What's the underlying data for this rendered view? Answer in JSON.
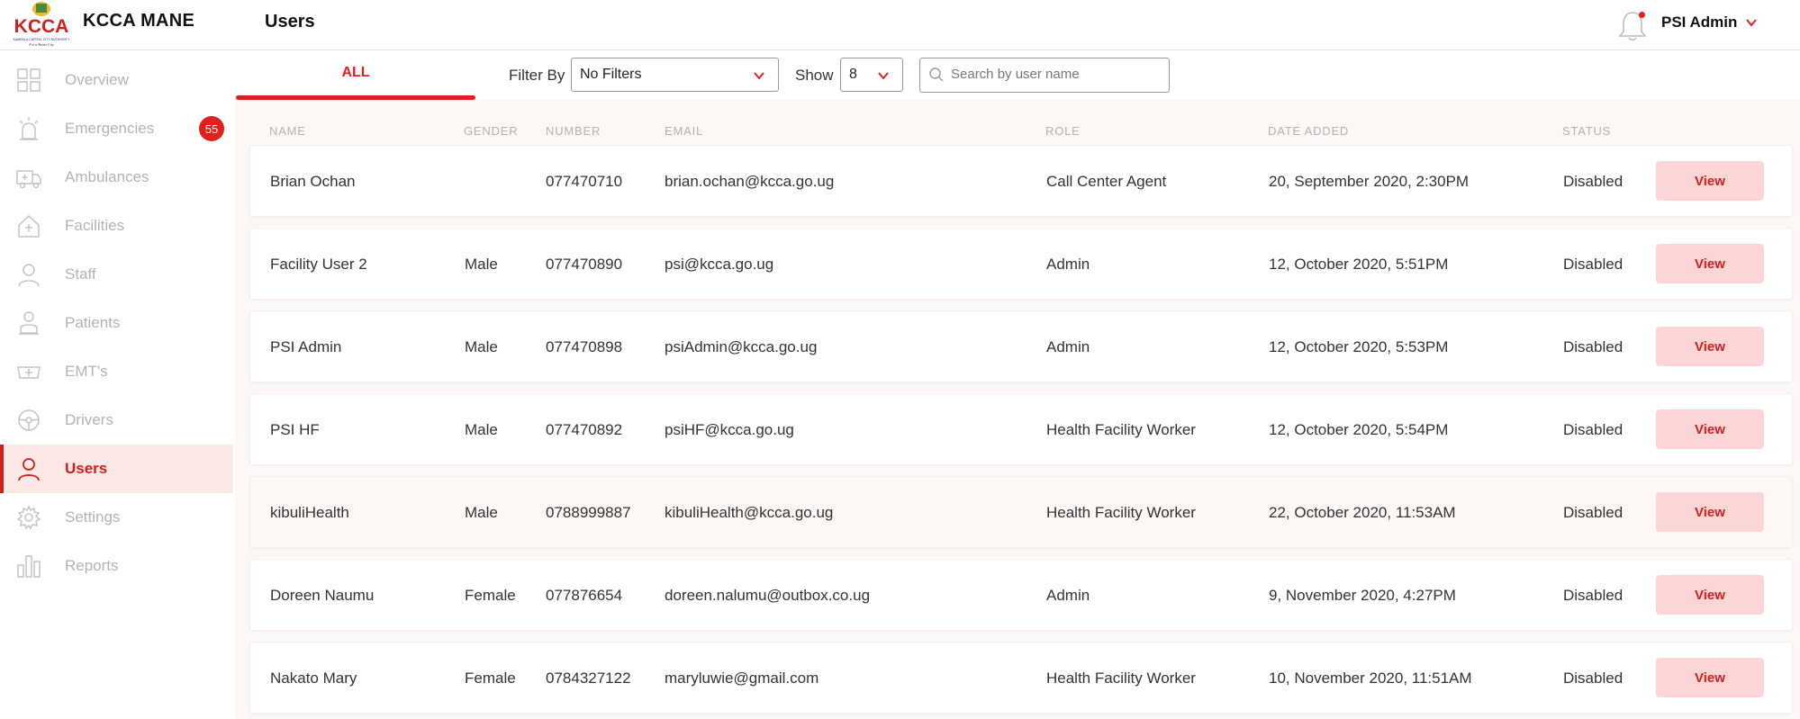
{
  "header": {
    "logo_text": "KCCA",
    "logo_subtext": "KAMPALA CAPITAL CITY AUTHORITY",
    "logo_tagline": "For a Better City",
    "app_name": "KCCA MANE",
    "page_title": "Users",
    "user_name": "PSI Admin"
  },
  "sidebar": {
    "items": [
      {
        "label": "Overview",
        "icon": "grid-icon"
      },
      {
        "label": "Emergencies",
        "icon": "siren-icon",
        "badge": "55"
      },
      {
        "label": "Ambulances",
        "icon": "ambulance-icon"
      },
      {
        "label": "Facilities",
        "icon": "facility-icon"
      },
      {
        "label": "Staff",
        "icon": "person-icon"
      },
      {
        "label": "Patients",
        "icon": "patient-icon"
      },
      {
        "label": "EMT's",
        "icon": "emt-icon"
      },
      {
        "label": "Drivers",
        "icon": "steering-wheel-icon"
      },
      {
        "label": "Users",
        "icon": "user-icon",
        "active": true
      },
      {
        "label": "Settings",
        "icon": "gear-icon"
      },
      {
        "label": "Reports",
        "icon": "bar-chart-icon"
      }
    ]
  },
  "toolbar": {
    "tab_all": "ALL",
    "filter_label": "Filter By",
    "filter_value": "No Filters",
    "show_label": "Show",
    "show_value": "8",
    "search_placeholder": "Search by user name"
  },
  "table": {
    "columns": [
      "NAME",
      "GENDER",
      "NUMBER",
      "EMAIL",
      "ROLE",
      "DATE ADDED",
      "STATUS"
    ],
    "view_label": "View",
    "rows": [
      {
        "name": "Brian Ochan",
        "gender": "",
        "number": "077470710",
        "email": "brian.ochan@kcca.go.ug",
        "role": "Call Center Agent",
        "date": "20, September 2020, 2:30PM",
        "status": "Disabled"
      },
      {
        "name": "Facility User 2",
        "gender": "Male",
        "number": "077470890",
        "email": "psi@kcca.go.ug",
        "role": "Admin",
        "date": "12, October 2020, 5:51PM",
        "status": "Disabled"
      },
      {
        "name": "PSI Admin",
        "gender": "Male",
        "number": "077470898",
        "email": "psiAdmin@kcca.go.ug",
        "role": "Admin",
        "date": "12, October 2020, 5:53PM",
        "status": "Disabled"
      },
      {
        "name": "PSI HF",
        "gender": "Male",
        "number": "077470892",
        "email": "psiHF@kcca.go.ug",
        "role": "Health Facility Worker",
        "date": "12, October 2020, 5:54PM",
        "status": "Disabled"
      },
      {
        "name": "kibuliHealth",
        "gender": "Male",
        "number": "0788999887",
        "email": "kibuliHealth@kcca.go.ug",
        "role": "Health Facility Worker",
        "date": "22, October 2020, 11:53AM",
        "status": "Disabled"
      },
      {
        "name": "Doreen Naumu",
        "gender": "Female",
        "number": "077876654",
        "email": "doreen.nalumu@outbox.co.ug",
        "role": "Admin",
        "date": "9, November 2020, 4:27PM",
        "status": "Disabled"
      },
      {
        "name": "Nakato Mary",
        "gender": "Female",
        "number": "0784327122",
        "email": "maryluwie@gmail.com",
        "role": "Health Facility Worker",
        "date": "10, November 2020, 11:51AM",
        "status": "Disabled"
      }
    ]
  },
  "colors": {
    "accent": "#e0201d",
    "active_bg": "#fde8e8",
    "view_button_bg": "#fcd6d6",
    "page_bg": "#fdf7f6"
  }
}
